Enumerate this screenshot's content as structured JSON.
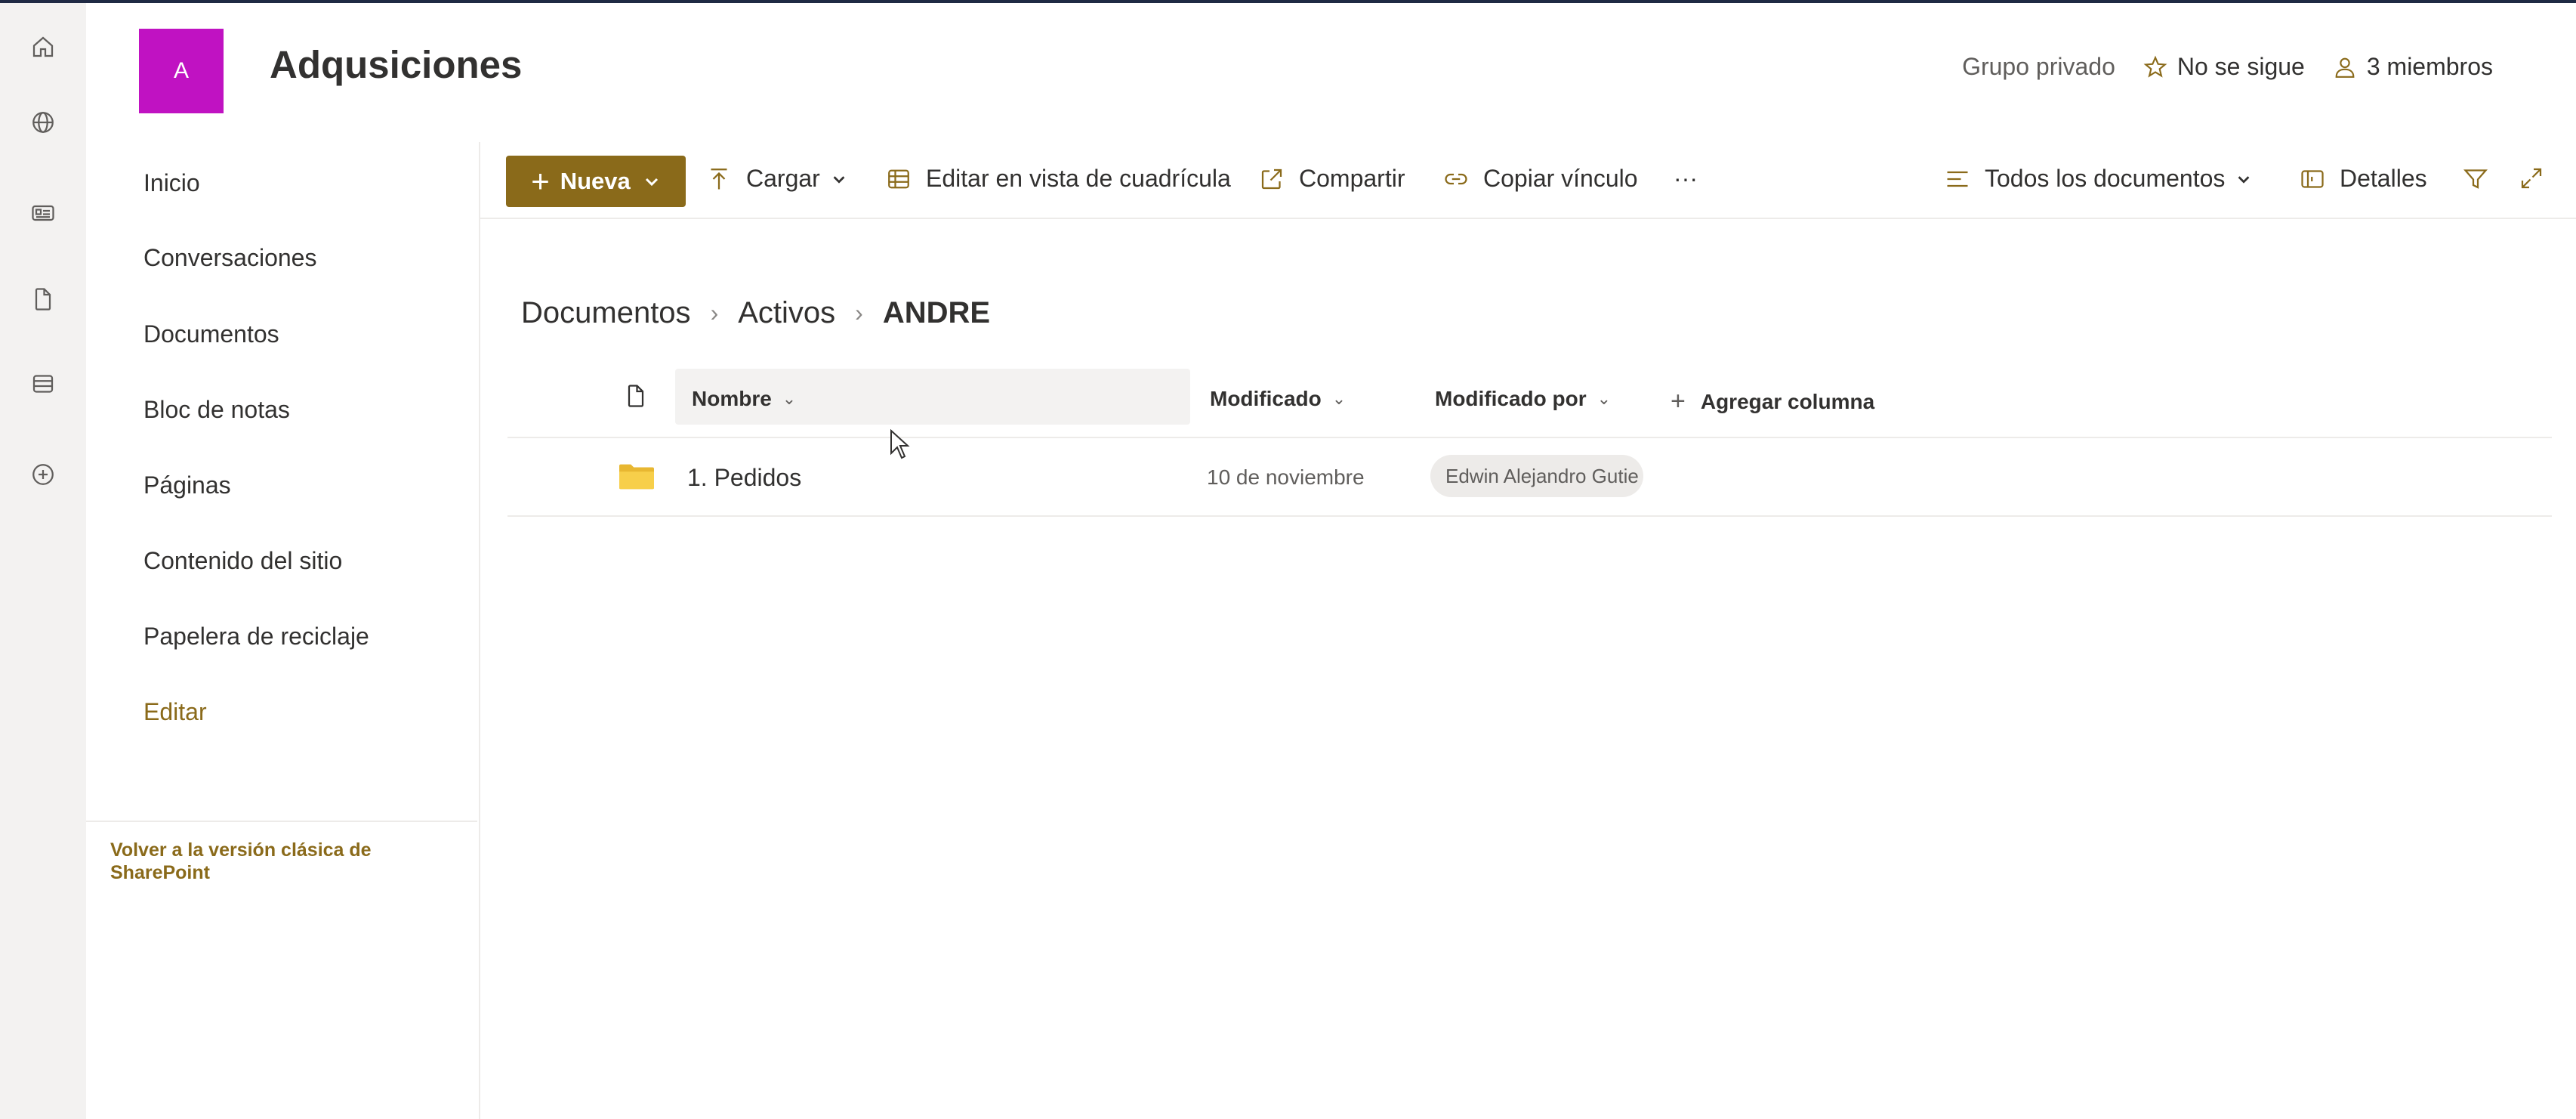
{
  "site": {
    "logo_letter": "A",
    "title": "Adqusiciones",
    "privacy": "Grupo privado",
    "follow_label": "No se sigue",
    "members_label": "3 miembros",
    "accent_color": "#8a6a1a",
    "logo_color": "#c012c2"
  },
  "rail": {
    "icons": [
      "home-icon",
      "globe-icon",
      "news-icon",
      "file-icon",
      "list-icon",
      "add-icon"
    ]
  },
  "nav": {
    "items": [
      "Inicio",
      "Conversaciones",
      "Documentos",
      "Bloc de notas",
      "Páginas",
      "Contenido del sitio",
      "Papelera de reciclaje"
    ],
    "edit_label": "Editar",
    "classic_link": "Volver a la versión clásica de SharePoint"
  },
  "commandbar": {
    "new_label": "Nueva",
    "upload_label": "Cargar",
    "grid_label": "Editar en vista de cuadrícula",
    "share_label": "Compartir",
    "copy_link_label": "Copiar vínculo",
    "more_label": "···",
    "view_label": "Todos los documentos",
    "details_label": "Detalles"
  },
  "breadcrumb": {
    "items": [
      "Documentos",
      "Activos"
    ],
    "current": "ANDRE",
    "separator": "›"
  },
  "list": {
    "columns": {
      "name": "Nombre",
      "modified": "Modificado",
      "modified_by": "Modificado por",
      "add_column": "Agregar columna"
    },
    "rows": [
      {
        "name": "1. Pedidos",
        "type": "folder",
        "modified": "10 de noviembre",
        "modified_by": "Edwin Alejandro Gutie"
      }
    ]
  }
}
